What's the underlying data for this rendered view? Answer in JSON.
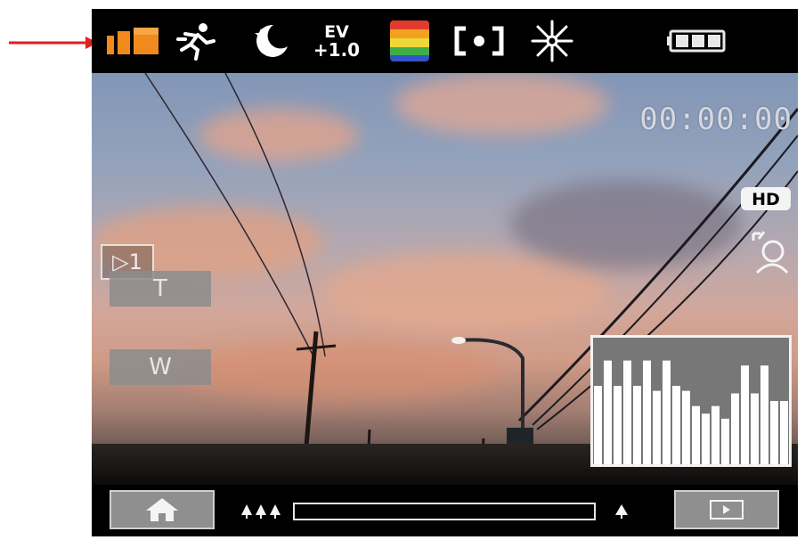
{
  "annotation": {
    "arrow_color": "#e21e1e"
  },
  "top_bar": {
    "icons": [
      "scene-mode-icon",
      "sports-mode-icon",
      "night-mode-icon",
      "ev-compensation-icon",
      "color-effect-icon",
      "spot-metering-icon",
      "white-balance-icon",
      "battery-icon"
    ],
    "ev_label": "EV",
    "ev_value": "+1.0",
    "colors": {
      "scene_icon": "#f08a1c",
      "battery": "#e8e8e8"
    }
  },
  "viewfinder": {
    "timecode": "00:00:00",
    "hd_label": "HD",
    "mode_badge": "▷1",
    "zoom_tele_label": "T",
    "zoom_wide_label": "W"
  },
  "histogram": {
    "levels": [
      0.62,
      0.82,
      0.62,
      0.82,
      0.62,
      0.82,
      0.58,
      0.82,
      0.62,
      0.58,
      0.46,
      0.4,
      0.46,
      0.36,
      0.56,
      0.78,
      0.56,
      0.78,
      0.5,
      0.5
    ]
  },
  "bottom_bar": {
    "home_icon": "home-icon",
    "play_icon": "play-icon",
    "zoom_level": 0.0
  }
}
